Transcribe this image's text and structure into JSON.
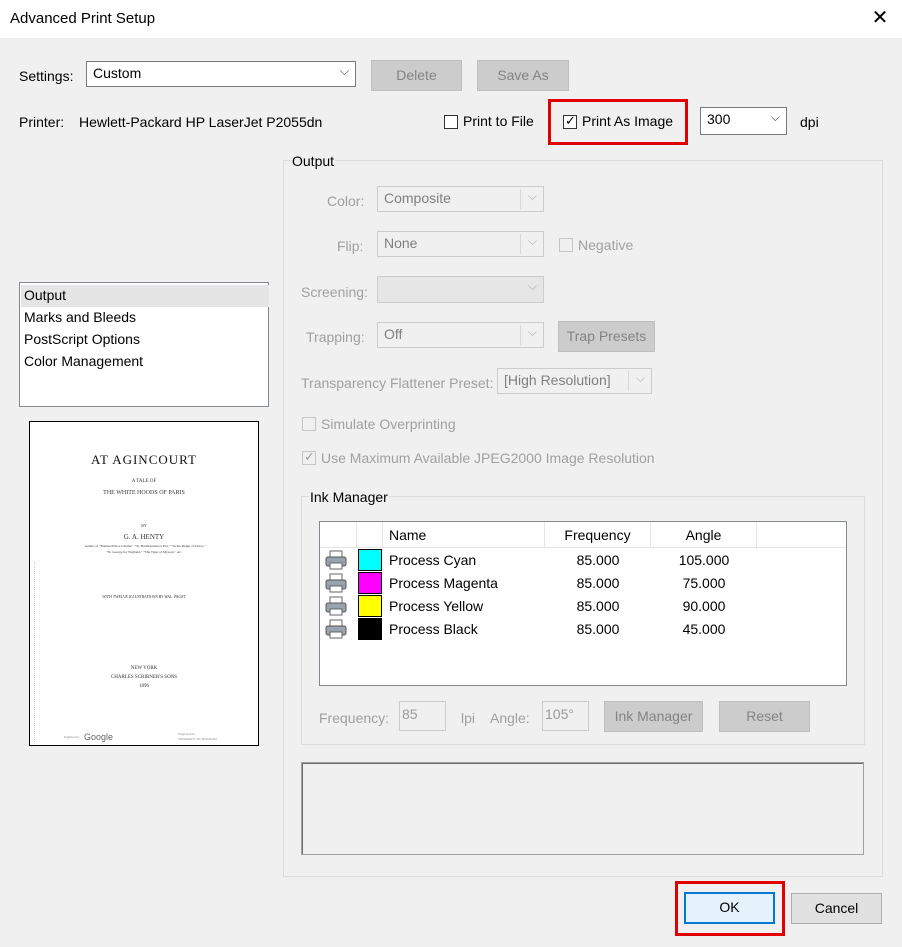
{
  "window": {
    "title": "Advanced Print Setup"
  },
  "settings": {
    "label": "Settings:",
    "value": "Custom",
    "delete_label": "Delete",
    "save_as_label": "Save As"
  },
  "printer": {
    "label": "Printer:",
    "name": "Hewlett-Packard HP LaserJet P2055dn",
    "print_to_file_label": "Print to File",
    "print_to_file_checked": false,
    "print_as_image_label": "Print As Image",
    "print_as_image_checked": true,
    "dpi_value": "300",
    "dpi_label": "dpi"
  },
  "nav": {
    "items": [
      {
        "label": "Output",
        "selected": true
      },
      {
        "label": "Marks and Bleeds",
        "selected": false
      },
      {
        "label": "PostScript Options",
        "selected": false
      },
      {
        "label": "Color Management",
        "selected": false
      }
    ]
  },
  "preview_page": {
    "title": "AT AGINCOURT",
    "subtitle1": "A TALE OF",
    "subtitle2": "THE WHITE HOODS OF PARIS",
    "by": "BY",
    "author": "G. A. HENTY",
    "author_line1": "Author of \"Bonnie Prince Charlie,\" \"St. Bartholomew's Eve,\" \"In the Reign of Terror,\"",
    "author_line2": "\"St. George for England,\" \"The Tiger of Mysore,\" etc.",
    "illustrations": "WITH TWELVE ILLUSTRATIONS BY WAL. PAGET",
    "city": "NEW YORK",
    "publisher": "CHARLES SCRIBNER'S SONS",
    "year": "1896",
    "google_prefix": "Digitized by",
    "google": "Google",
    "library1": "Original from",
    "library2": "UNIVERSITY OF MICHIGAN"
  },
  "output": {
    "group_label": "Output",
    "color_label": "Color:",
    "color_value": "Composite",
    "flip_label": "Flip:",
    "flip_value": "None",
    "negative_label": "Negative",
    "screening_label": "Screening:",
    "screening_value": "",
    "trapping_label": "Trapping:",
    "trapping_value": "Off",
    "trap_presets_label": "Trap Presets",
    "transparency_label": "Transparency Flattener Preset:",
    "transparency_value": "[High Resolution]",
    "simulate_overprinting_label": "Simulate Overprinting",
    "jpeg2000_label": "Use Maximum Available JPEG2000 Image Resolution"
  },
  "ink_manager": {
    "group_label": "Ink Manager",
    "columns": [
      "Name",
      "Frequency",
      "Angle"
    ],
    "inks": [
      {
        "name": "Process Cyan",
        "frequency": "85.000",
        "angle": "105.000",
        "color": "#00ffff"
      },
      {
        "name": "Process Magenta",
        "frequency": "85.000",
        "angle": "75.000",
        "color": "#ff00ff"
      },
      {
        "name": "Process Yellow",
        "frequency": "85.000",
        "angle": "90.000",
        "color": "#ffff00"
      },
      {
        "name": "Process Black",
        "frequency": "85.000",
        "angle": "45.000",
        "color": "#000000"
      }
    ],
    "frequency_label": "Frequency:",
    "frequency_value": "85",
    "lpi_label": "lpi",
    "angle_label": "Angle:",
    "angle_value": "105°",
    "ink_manager_button": "Ink Manager",
    "reset_button": "Reset"
  },
  "footer": {
    "ok_label": "OK",
    "cancel_label": "Cancel"
  },
  "colors": {
    "highlight_red": "#e00000",
    "focus_blue": "#0078d7"
  },
  "icons": {
    "close": "close-icon",
    "dropdown": "chevron-down-icon",
    "printer": "printer-icon",
    "checkmark": "checkmark-icon"
  }
}
